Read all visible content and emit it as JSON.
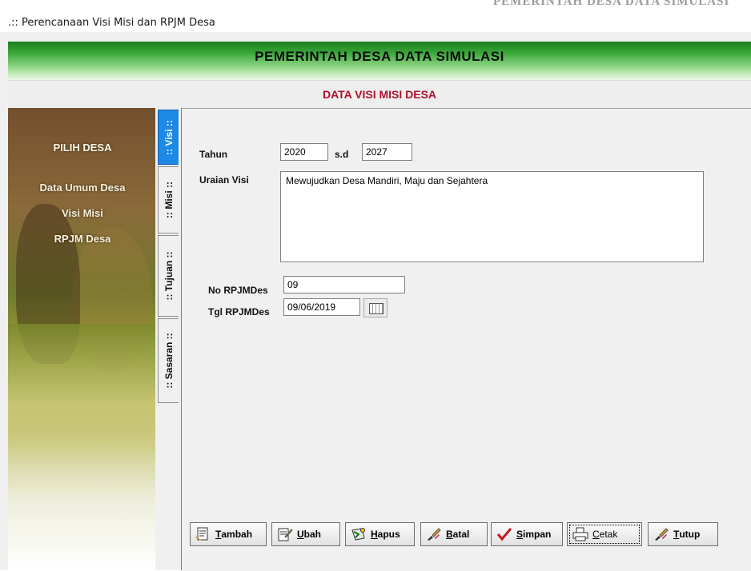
{
  "window": {
    "title": ".:: Perencanaan Visi Misi dan RPJM Desa",
    "background_text": "PEMERINTAH DESA DATA SIMULASI"
  },
  "header": {
    "title": "PEMERINTAH DESA DATA SIMULASI",
    "subtitle": "DATA VISI MISI DESA"
  },
  "sidebar": {
    "title": "PILIH DESA",
    "items": [
      {
        "label": "Data Umum Desa"
      },
      {
        "label": "Visi Misi"
      },
      {
        "label": "RPJM Desa"
      }
    ]
  },
  "tabs": [
    {
      "label": ":: Visi ::",
      "active": true
    },
    {
      "label": ":: Misi ::",
      "active": false
    },
    {
      "label": ":: Tujuan ::",
      "active": false
    },
    {
      "label": ":: Sasaran ::",
      "active": false
    }
  ],
  "form": {
    "tahun_label": "Tahun",
    "tahun_start": "2020",
    "sd_label": "s.d",
    "tahun_end": "2027",
    "uraian_label": "Uraian Visi",
    "uraian_value": "Mewujudkan Desa Mandiri, Maju dan Sejahtera",
    "no_label": "No RPJMDes",
    "no_value": "09",
    "tgl_label": "Tgl RPJMDes",
    "tgl_value": "09/06/2019"
  },
  "buttons": [
    {
      "key": "T",
      "rest": "ambah",
      "icon": "add-document-icon"
    },
    {
      "key": "U",
      "rest": "bah",
      "icon": "edit-document-icon"
    },
    {
      "key": "H",
      "rest": "apus",
      "icon": "delete-icon"
    },
    {
      "key": "B",
      "rest": "atal",
      "icon": "cancel-brush-icon"
    },
    {
      "key": "S",
      "rest": "impan",
      "icon": "checkmark-icon"
    },
    {
      "key": "C",
      "rest": "etak",
      "icon": "printer-icon"
    },
    {
      "key": "T",
      "rest": "utup",
      "icon": "close-brush-icon"
    }
  ],
  "colors": {
    "header_green": "#2e9a2e",
    "subtitle_red": "#b0122c",
    "active_tab_blue": "#1e88e5"
  }
}
